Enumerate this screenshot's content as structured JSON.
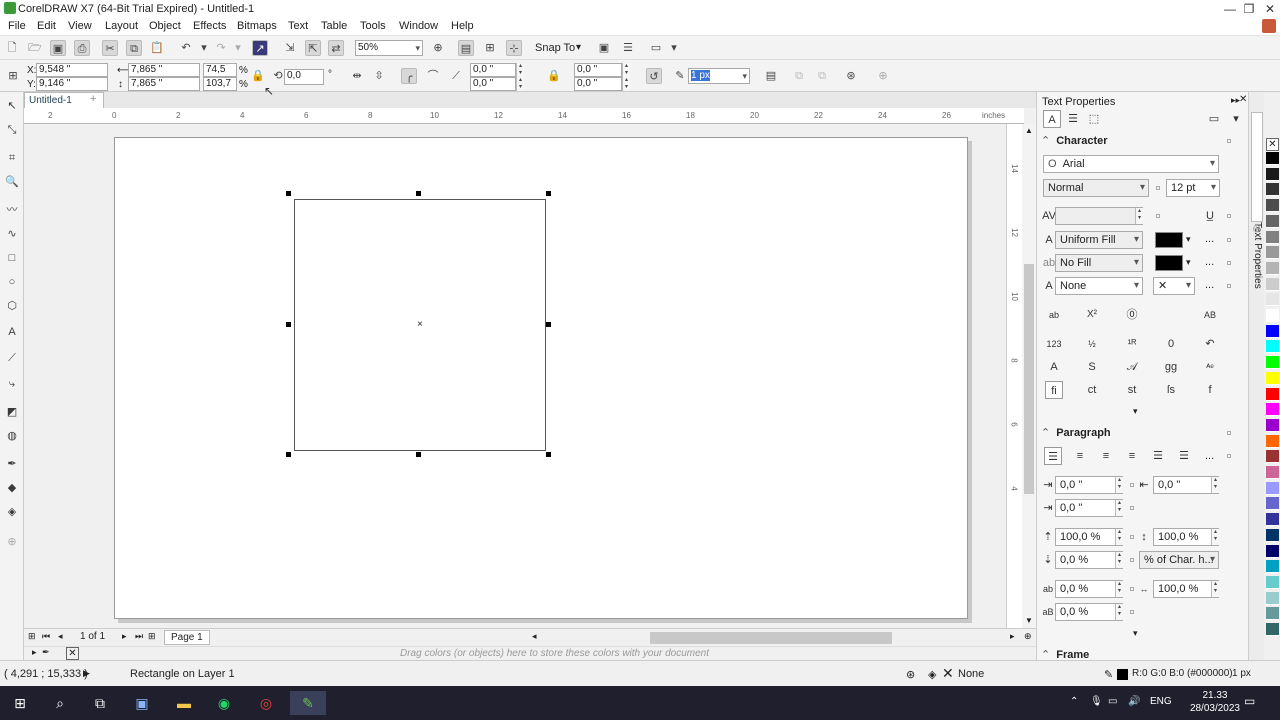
{
  "window": {
    "title": "CorelDRAW X7 (64-Bit Trial Expired) - Untitled-1",
    "minimize": "—",
    "restore": "❐",
    "close": "✕"
  },
  "menu": [
    "File",
    "Edit",
    "View",
    "Layout",
    "Object",
    "Effects",
    "Bitmaps",
    "Text",
    "Table",
    "Tools",
    "Window",
    "Help"
  ],
  "standard_toolbar": {
    "zoom": "50%",
    "snap_to": "Snap To"
  },
  "property_bar": {
    "x": "9,548 \"",
    "y": "9,146 \"",
    "width": "7,865 \"",
    "height": "7,865 \"",
    "scale_x": "74,5",
    "scale_y": "103,7",
    "percent": "%",
    "rotation": "0,0",
    "degree": "°",
    "corner_tl": "0,0 \"",
    "corner_bl": "0,0 \"",
    "corner_tr": "0,0 \"",
    "corner_br": "0,0 \"",
    "outline_width": "1 px"
  },
  "document": {
    "tab": "Untitled-1",
    "ruler_units": "inches"
  },
  "ruler": {
    "h_ticks": [
      "2",
      "0",
      "2",
      "4",
      "6",
      "8",
      "10",
      "12",
      "14",
      "16",
      "18",
      "20",
      "22",
      "24",
      "26"
    ],
    "v_ticks": [
      "14",
      "12",
      "10",
      "8",
      "6",
      "4"
    ]
  },
  "pager": {
    "count": "1 of 1",
    "page_tab": "Page 1"
  },
  "tray_hint": "Drag colors (or objects) here to store these colors with your document",
  "docker": {
    "title": "Text Properties",
    "vtab": "Text Properties",
    "character": {
      "header": "Character",
      "font": "Arial",
      "style": "Normal",
      "size": "12 pt",
      "fill_type": "Uniform Fill",
      "bg_fill_type": "No Fill",
      "outline": "None",
      "more": "...",
      "expand": "▾"
    },
    "paragraph": {
      "header": "Paragraph",
      "indent_left": "0,0 \"",
      "indent_first": "0,0 \"",
      "indent_right": "0,0 \"",
      "line_spacing": "100,0 %",
      "para_spacing_before": "100,0 %",
      "para_spacing_after": "0,0 %",
      "spacing_unit": "% of Char. h...",
      "char_spacing": "0,0 %",
      "word_spacing": "100,0 %",
      "lang_spacing": "0,0 %",
      "more": "...",
      "expand": "▾"
    },
    "frame": {
      "header": "Frame"
    }
  },
  "palette": [
    "#ffffff",
    "#000000",
    "#1a1a1a",
    "#333333",
    "#4d4d4d",
    "#666666",
    "#808080",
    "#999999",
    "#b3b3b3",
    "#cccccc",
    "#e6e6e6",
    "#ffffff",
    "#0000ff",
    "#00ffff",
    "#00ff00",
    "#ffff00",
    "#ff0000",
    "#ff00ff",
    "#9900cc",
    "#ff6600",
    "#993333",
    "#cc6699",
    "#9999ff",
    "#6666cc",
    "#333399",
    "#003366",
    "#000066",
    "#00a0c0",
    "#66cccc",
    "#99cccc",
    "#669999",
    "#336666"
  ],
  "status": {
    "coords": "( 4,291 ; 15,333 )",
    "object": "Rectangle on Layer 1",
    "fill": "None",
    "outline_color": "R:0 G:0 B:0 (#000000)",
    "outline_width": "1 px"
  },
  "taskbar": {
    "time": "21.33",
    "date": "28/03/2023",
    "lang": "ENG"
  }
}
